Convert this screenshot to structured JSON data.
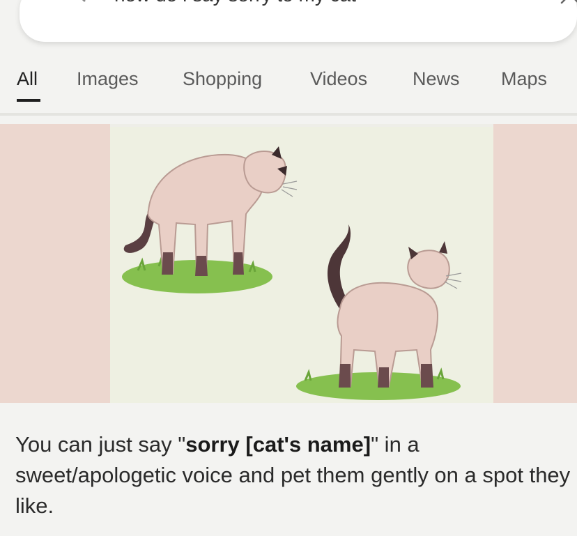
{
  "search": {
    "query": "how do i say sorry to my cat",
    "icon": "search-icon",
    "clear_icon": "close-icon"
  },
  "tabs": [
    {
      "label": "All",
      "active": true
    },
    {
      "label": "Images"
    },
    {
      "label": "Shopping"
    },
    {
      "label": "Videos"
    },
    {
      "label": "News"
    },
    {
      "label": "Maps"
    }
  ],
  "image": {
    "subject": "illustration-two-siamese-cats",
    "side_color": "#ecd7cf"
  },
  "answer": {
    "prefix": "You can just say \"",
    "bold": "sorry [cat's name]",
    "suffix": "\" in a sweet/apologetic voice and pet them gently on a spot they like."
  },
  "colors": {
    "active_tab": "#222222",
    "inactive_tab": "#5a5a5a",
    "grass": "#86c04f"
  }
}
